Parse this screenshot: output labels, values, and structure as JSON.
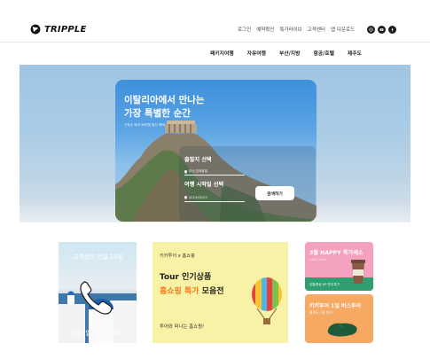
{
  "brand": {
    "name": "TRIPPLE"
  },
  "topnav": {
    "items": [
      "로그인",
      "예약확인",
      "특가라이브",
      "고객센터",
      "앱 다운로드"
    ]
  },
  "socials": [
    "instagram-icon",
    "youtube-icon",
    "facebook-icon"
  ],
  "mainnav": {
    "items": [
      "패키지여행",
      "자유여행",
      "부산/지방",
      "항공/호텔",
      "제주도"
    ]
  },
  "hero": {
    "title_line1": "이탈리아에서 만나는",
    "title_line2": "가장 특별한 순간",
    "subtitle": "선착순 최대 30만원 할인 혜택",
    "departure_label": "출발지 선택",
    "departure_value": "부산/김해출발",
    "date_label": "여행 시작일 선택",
    "date_value": "2023/05/23",
    "search_button": "검색하기"
  },
  "banners": {
    "greece": {
      "line": "고객센터 연결 10일",
      "timer": "마감 0일 07:53:44"
    },
    "shopping": {
      "top": "키키투어 x 홈쇼핑",
      "line1": "Tour 인기상품",
      "line2_em": "홈쇼핑 특가",
      "line2_rest": " 모음전",
      "foot": "투어와 떠나는 홈쇼핑!"
    },
    "happy": {
      "title": "3월 HAPPY 특가세소",
      "sub": "SALE SALE",
      "badge": "호텔/항공 HP 연계 특가"
    },
    "jeju": {
      "title": "키키투어 1일 버스투어",
      "sub": "제주도 1일 투어"
    }
  },
  "colors": {
    "shopping_bg": "#f7f2a6",
    "happy_bg": "#f4a1bf",
    "jeju_bg": "#f6a963",
    "accent_orange": "#ff7a1a"
  }
}
